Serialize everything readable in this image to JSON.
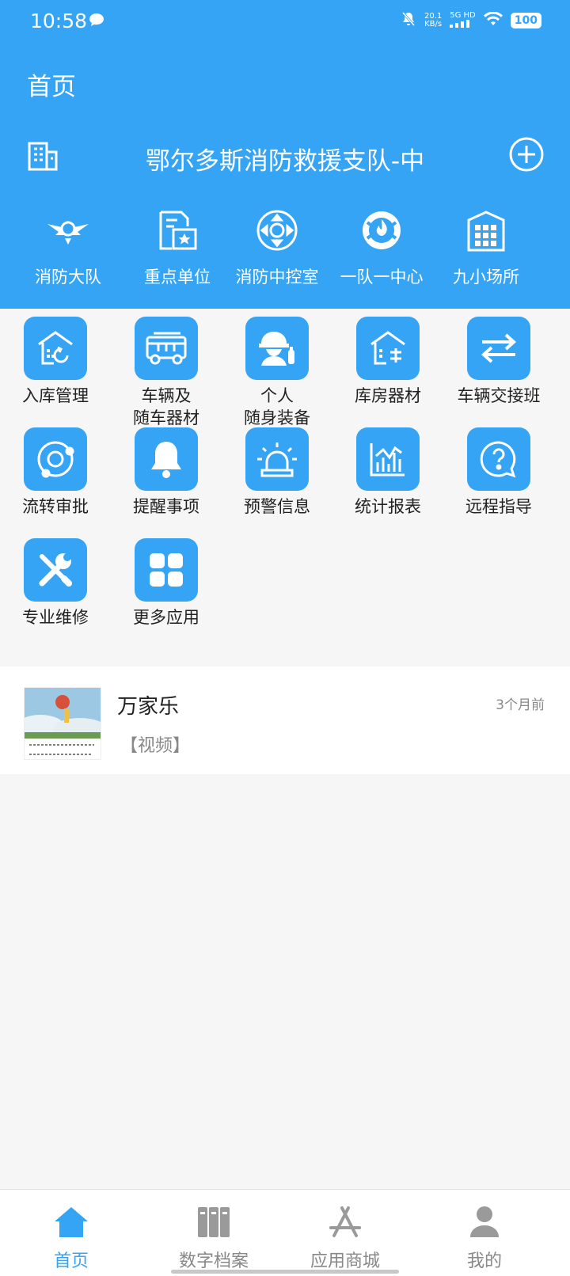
{
  "status_bar": {
    "time": "10:58",
    "speed_value": "20.1",
    "speed_unit": "KB/s",
    "network": "5G HD",
    "battery": "100"
  },
  "header": {
    "title": "首页",
    "org_name": "鄂尔多斯消防救援支队-中"
  },
  "quick_actions": [
    {
      "label": "消防大队",
      "icon": "fire-brigade-emblem-icon"
    },
    {
      "label": "重点单位",
      "icon": "key-unit-icon"
    },
    {
      "label": "消防中控室",
      "icon": "control-room-icon"
    },
    {
      "label": "一队一中心",
      "icon": "fire-center-icon"
    },
    {
      "label": "九小场所",
      "icon": "small-venue-icon"
    }
  ],
  "apps": [
    {
      "label": "入库管理",
      "icon": "warehouse-in-icon"
    },
    {
      "label": "车辆及\n随车器材",
      "icon": "fire-truck-icon"
    },
    {
      "label": "个人\n随身装备",
      "icon": "firefighter-gear-icon"
    },
    {
      "label": "库房器材",
      "icon": "storeroom-icon"
    },
    {
      "label": "车辆交接班",
      "icon": "swap-arrows-icon"
    },
    {
      "label": "流转审批",
      "icon": "orbit-approval-icon"
    },
    {
      "label": "提醒事项",
      "icon": "bell-icon"
    },
    {
      "label": "预警信息",
      "icon": "alarm-light-icon"
    },
    {
      "label": "统计报表",
      "icon": "bar-chart-icon"
    },
    {
      "label": "远程指导",
      "icon": "help-chat-icon"
    },
    {
      "label": "专业维修",
      "icon": "tools-icon"
    },
    {
      "label": "更多应用",
      "icon": "more-apps-icon"
    }
  ],
  "news": [
    {
      "title": "万家乐",
      "tag": "【视频】",
      "time": "3个月前"
    }
  ],
  "tabbar": [
    {
      "label": "首页",
      "icon": "home-icon",
      "active": true
    },
    {
      "label": "数字档案",
      "icon": "archive-icon",
      "active": false
    },
    {
      "label": "应用商城",
      "icon": "app-store-icon",
      "active": false
    },
    {
      "label": "我的",
      "icon": "profile-icon",
      "active": false
    }
  ],
  "colors": {
    "primary": "#36a4f4",
    "background": "#f6f6f6"
  }
}
